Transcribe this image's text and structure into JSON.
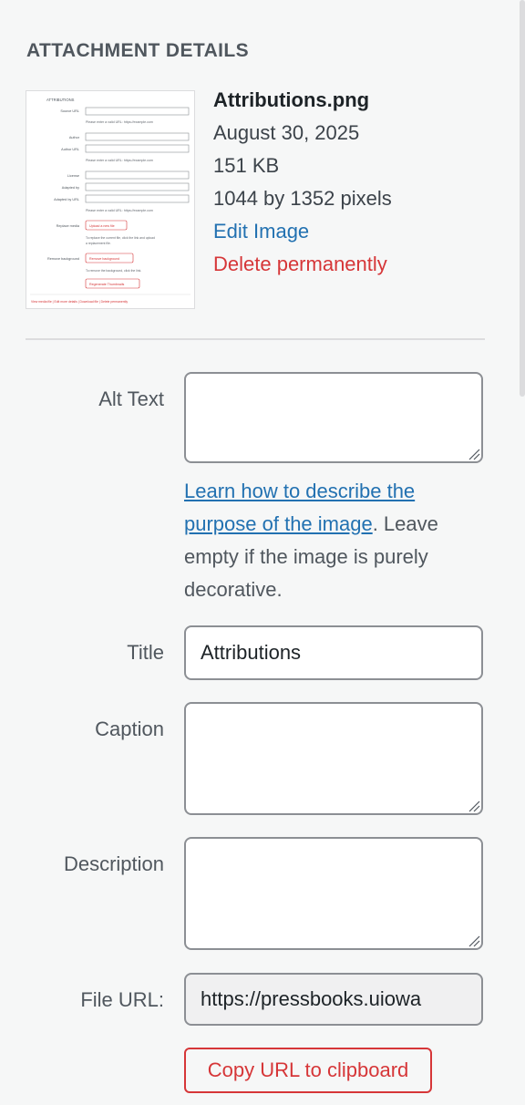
{
  "panel": {
    "heading": "ATTACHMENT DETAILS"
  },
  "attachment": {
    "filename": "Attributions.png",
    "date": "August 30, 2025",
    "size": "151 KB",
    "dimensions": "1044 by 1352 pixels",
    "edit_link": "Edit Image",
    "delete_link": "Delete permanently"
  },
  "thumbnail": {
    "heading": "ATTRIBUTIONS",
    "rows": [
      "Source URL",
      "Author",
      "Author URL",
      "License",
      "Adapted by",
      "Adapted by URL",
      "Replace media",
      "Remove background"
    ],
    "hint_url": "Please enter a valid URL: https://example.com",
    "upload_button": "Upload a new file",
    "replace_help_1": "To replace the current file, click the link and upload",
    "replace_help_2": "a replacement file.",
    "remove_bg_button": "Remove background",
    "remove_bg_help": "To remove the background, click the link.",
    "regen_button": "Regenerate Thumbnails",
    "footer": "View media file | Edit more details | Download file | Delete permanently"
  },
  "fields": {
    "alt_text": {
      "label": "Alt Text",
      "value": ""
    },
    "alt_help": {
      "link": "Learn how to describe the purpose of the image",
      "text": ". Leave empty if the image is purely decorative."
    },
    "title": {
      "label": "Title",
      "value": "Attributions"
    },
    "caption": {
      "label": "Caption",
      "value": ""
    },
    "description": {
      "label": "Description",
      "value": ""
    },
    "file_url": {
      "label": "File URL:",
      "value": "https://pressbooks.uiowa"
    }
  },
  "buttons": {
    "copy_url": "Copy URL to clipboard"
  },
  "colors": {
    "accent": "#2271b1",
    "danger": "#d63638",
    "background": "#f6f7f7"
  },
  "icons": {
    "resize": "resize-grip-icon"
  }
}
